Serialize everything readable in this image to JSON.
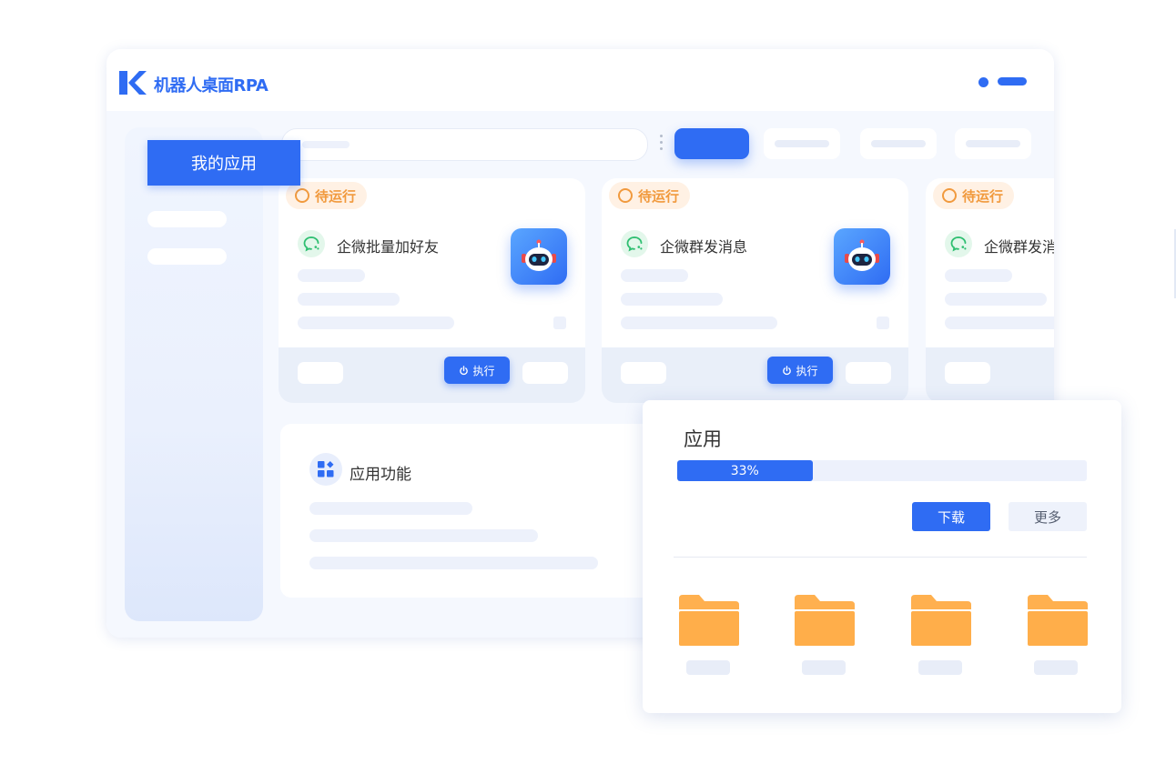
{
  "app": {
    "title": "机器人桌面RPA"
  },
  "sidebar": {
    "active_item": "我的应用"
  },
  "tasks": [
    {
      "status": "待运行",
      "name": "企微批量加好友",
      "run_label": "执行"
    },
    {
      "status": "待运行",
      "name": "企微群发消息",
      "run_label": "执行"
    },
    {
      "status": "待运行",
      "name": "企微群发消"
    }
  ],
  "features": {
    "title": "应用功能"
  },
  "download_dialog": {
    "title": "应用",
    "progress": 33,
    "progress_label": "33%",
    "download_label": "下载",
    "more_label": "更多"
  },
  "colors": {
    "primary": "#2f6cf3",
    "status_orange": "#f19a3e",
    "folder": "#ffb04f",
    "wechat_green": "#2fbf71"
  },
  "icons": [
    "k-logo-icon",
    "wechat-icon",
    "robot-icon",
    "power-icon",
    "grid-icon",
    "folder-icon"
  ]
}
